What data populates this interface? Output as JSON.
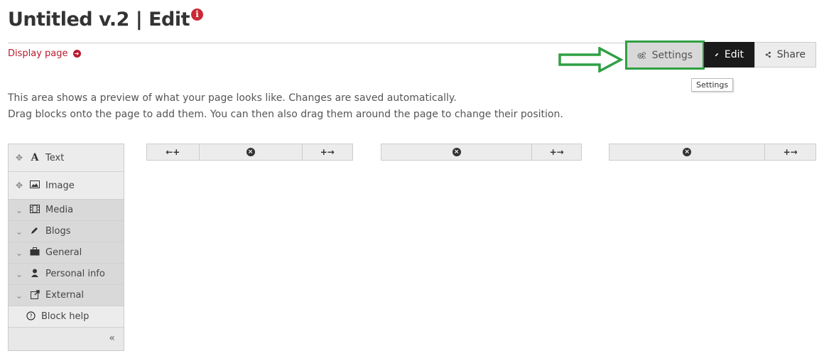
{
  "header": {
    "title": "Untitled v.2 | Edit",
    "info_icon": "info-icon",
    "display_link": "Display page"
  },
  "toolbar": {
    "settings_label": "Settings",
    "edit_label": "Edit",
    "share_label": "Share",
    "tooltip": "Settings",
    "highlight_color": "#2ea043"
  },
  "description": {
    "line1": "This area shows a preview of what your page looks like. Changes are saved automatically.",
    "line2": "Drag blocks onto the page to add them. You can then also drag them around the page to change their position."
  },
  "palette": {
    "items": [
      {
        "label": "Text",
        "icon": "text-icon"
      },
      {
        "label": "Image",
        "icon": "image-icon"
      }
    ],
    "categories": [
      {
        "label": "Media",
        "icon": "film-icon"
      },
      {
        "label": "Blogs",
        "icon": "pencil-icon"
      },
      {
        "label": "General",
        "icon": "briefcase-icon"
      },
      {
        "label": "Personal info",
        "icon": "user-icon"
      },
      {
        "label": "External",
        "icon": "external-link-icon"
      }
    ],
    "help_label": "Block help",
    "collapse_label": "«"
  },
  "columns": [
    {
      "left_label": "←+",
      "remove_icon": "×",
      "right_label": "+→"
    },
    {
      "remove_icon": "×",
      "right_label": "+→"
    },
    {
      "remove_icon": "×",
      "right_label": "+→"
    }
  ]
}
